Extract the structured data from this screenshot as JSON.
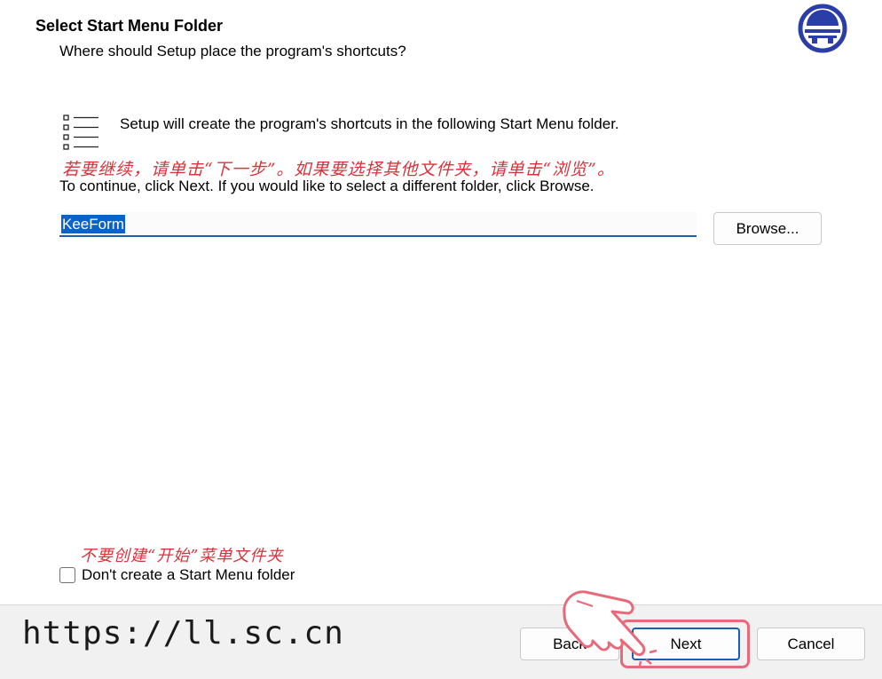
{
  "header": {
    "title": "Select Start Menu Folder",
    "subtitle": "Where should Setup place the program's shortcuts?",
    "logo_icon": "installer-logo-icon"
  },
  "body": {
    "intro_text": "Setup will create the program's shortcuts in the following Start Menu folder.",
    "annotation_continue_cn": "若要继续，请单击“下一步”。如果要选择其他文件夹，请单击“浏览”。",
    "continue_text": "To continue, click Next. If you would like to select a different folder, click Browse.",
    "folder_value": "KeeForm",
    "browse_label": "Browse...",
    "annotation_checkbox_cn": "不要创建“开始”菜单文件夹",
    "checkbox_label": "Don't create a Start Menu folder",
    "checkbox_checked": false
  },
  "footer": {
    "watermark": "https://ll.sc.cn",
    "back_label": "Back",
    "next_label": "Next",
    "cancel_label": "Cancel"
  },
  "colors": {
    "accent": "#1a5fb4",
    "annotation": "#d9323a",
    "highlight": "#e86a7a",
    "logo": "#2b3ea8"
  }
}
